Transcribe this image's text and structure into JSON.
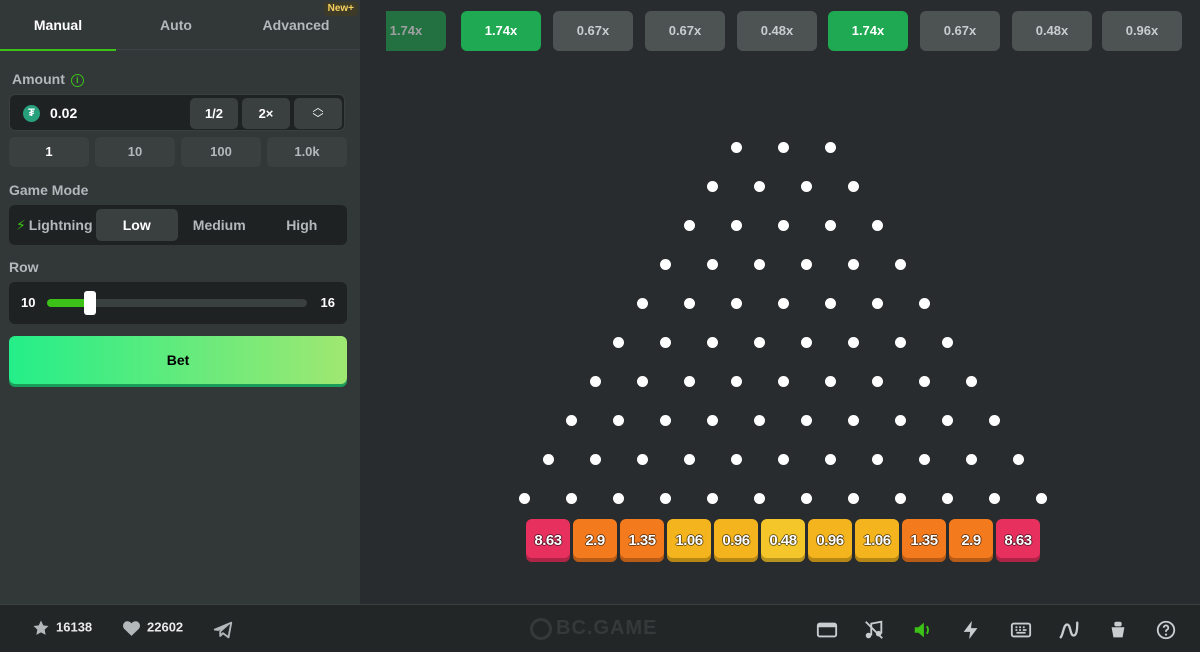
{
  "tabs": [
    {
      "label": "Manual",
      "active": true
    },
    {
      "label": "Auto",
      "active": false
    },
    {
      "label": "Advanced",
      "active": false
    }
  ],
  "new_badge": "New",
  "amount": {
    "label": "Amount",
    "value": "0.02",
    "currency_icon": "tether-coin-icon",
    "half_label": "1/2",
    "double_label": "2×"
  },
  "presets": [
    "1",
    "10",
    "100",
    "1.0k"
  ],
  "game_mode": {
    "label": "Game Mode",
    "options": [
      "Lightning",
      "Low",
      "Medium",
      "High"
    ],
    "selected": "Low"
  },
  "row": {
    "label": "Row",
    "min": "10",
    "max": "16",
    "value": 11
  },
  "bet_label": "Bet",
  "history": [
    {
      "value": "1.74x",
      "win": true
    },
    {
      "value": "1.74x",
      "win": true
    },
    {
      "value": "0.67x",
      "win": false
    },
    {
      "value": "0.67x",
      "win": false
    },
    {
      "value": "0.48x",
      "win": false
    },
    {
      "value": "1.74x",
      "win": true
    },
    {
      "value": "0.67x",
      "win": false
    },
    {
      "value": "0.48x",
      "win": false
    },
    {
      "value": "0.96x",
      "win": false
    }
  ],
  "multipliers": [
    {
      "value": "8.63",
      "color": "#e8305e"
    },
    {
      "value": "2.9",
      "color": "#f47a1e"
    },
    {
      "value": "1.35",
      "color": "#f47a1e"
    },
    {
      "value": "1.06",
      "color": "#f4b41e"
    },
    {
      "value": "0.96",
      "color": "#f4b41e"
    },
    {
      "value": "0.48",
      "color": "#f4c62a"
    },
    {
      "value": "0.96",
      "color": "#f4b41e"
    },
    {
      "value": "1.06",
      "color": "#f4b41e"
    },
    {
      "value": "1.35",
      "color": "#f47a1e"
    },
    {
      "value": "2.9",
      "color": "#f47a1e"
    },
    {
      "value": "8.63",
      "color": "#e8305e"
    }
  ],
  "footer": {
    "stars": "16138",
    "likes": "22602",
    "brand": "BC.GAME",
    "icons": [
      "screen-icon",
      "music-icon",
      "sound-icon",
      "lightning-icon",
      "keyboard-icon",
      "chart-icon",
      "pot-icon",
      "help-icon"
    ]
  },
  "colors": {
    "accent": "#3bc117",
    "win_chip": "#1fa952"
  }
}
